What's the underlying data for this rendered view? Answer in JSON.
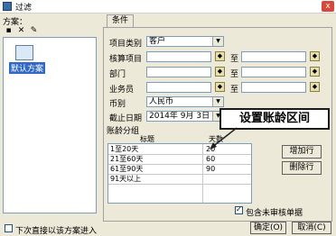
{
  "window": {
    "title": "过滤",
    "close_label": "x"
  },
  "left": {
    "scheme_label": "方案：",
    "scheme_name": "默认方案",
    "direct_enter_label": "下次直接以该方案进入"
  },
  "tabs": [
    {
      "label": "条件"
    }
  ],
  "form": {
    "project_type_label": "项目类别",
    "project_type_value": "客户",
    "accounting_item_label": "核算项目",
    "department_label": "部门",
    "salesperson_label": "业务员",
    "to_label": "至",
    "currency_label": "币别",
    "currency_value": "人民币",
    "cutoff_date_label": "截止日期",
    "cutoff_date_value": "2014年 9月 3日",
    "aging_group_label": "账龄分组"
  },
  "aging_table": {
    "col1": "标题",
    "col2": "天数",
    "rows": [
      {
        "title": "1至20天",
        "days": "20"
      },
      {
        "title": "21至60天",
        "days": "60"
      },
      {
        "title": "61至90天",
        "days": "90"
      },
      {
        "title": "91天以上",
        "days": ""
      }
    ]
  },
  "buttons": {
    "add_row": "增加行",
    "delete_row": "删除行",
    "ok": "确定(O)",
    "cancel": "取消(C)"
  },
  "include_unaudited_label": "包含未审核单据",
  "annotation": "设置账龄区间"
}
